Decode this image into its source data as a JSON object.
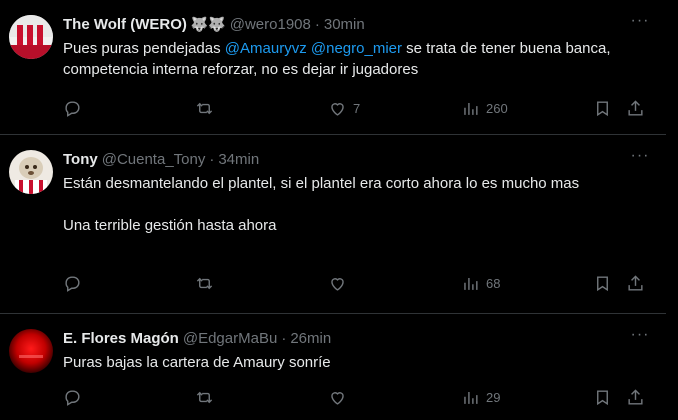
{
  "tweets": [
    {
      "name": "The Wolf (WERO)",
      "emojis": "🐺🐺",
      "handle": "@wero1908",
      "time": "30min",
      "text_before": "Pues puras pendejadas ",
      "mention1": "@Amauryvz",
      "mention2": "@negro_mier",
      "text_after": " se trata de tener buena banca, competencia interna reforzar, no es dejar ir jugadores",
      "likes": "7",
      "views": "260",
      "avatar_colors": [
        "#c8102e",
        "#ffffff"
      ]
    },
    {
      "name": "Tony",
      "handle": "@Cuenta_Tony",
      "time": "34min",
      "para1": "Están desmantelando el plantel, si el plantel era corto ahora lo es mucho mas",
      "para2": "Una terrible gestión hasta ahora",
      "views": "68",
      "avatar_colors": [
        "#d8d2c8",
        "#8a6d4f"
      ]
    },
    {
      "name": "E. Flores Magón",
      "handle": "@EdgarMaBu",
      "time": "26min",
      "text": "Puras bajas la cartera de Amaury sonríe",
      "views": "29",
      "avatar_colors": [
        "#e00000",
        "#5a0000"
      ]
    }
  ],
  "separator": "·",
  "more_label": "···",
  "icons": [
    "reply-icon",
    "retweet-icon",
    "like-icon",
    "views-icon",
    "bookmark-icon",
    "share-icon"
  ]
}
